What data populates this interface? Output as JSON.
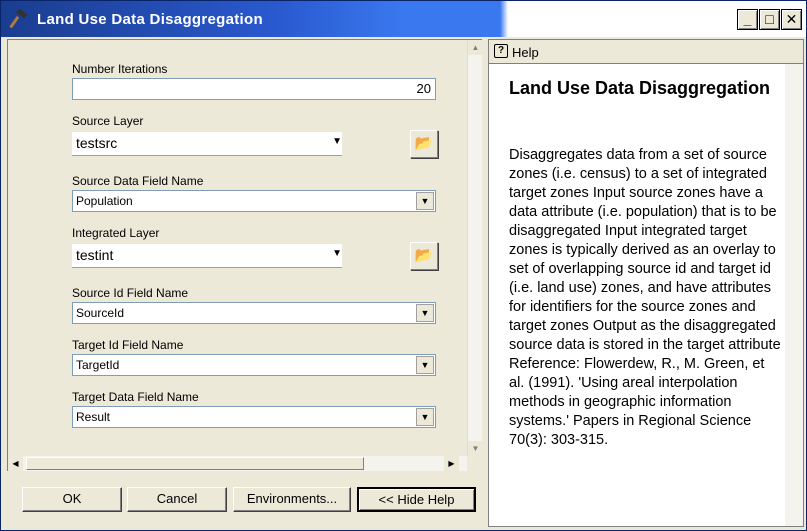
{
  "window": {
    "title": "Land Use Data Disaggregation",
    "min_glyph": "_",
    "max_glyph": "□",
    "close_glyph": "✕"
  },
  "form": {
    "iterations": {
      "label": "Number Iterations",
      "value": "20"
    },
    "source_layer": {
      "label": "Source Layer",
      "value": "testsrc"
    },
    "source_data_field": {
      "label": "Source Data Field Name",
      "value": "Population"
    },
    "integrated_layer": {
      "label": "Integrated Layer",
      "value": "testint"
    },
    "source_id_field": {
      "label": "Source Id Field Name",
      "value": "SourceId"
    },
    "target_id_field": {
      "label": "Target Id Field Name",
      "value": "TargetId"
    },
    "target_data_field": {
      "label": "Target Data Field Name",
      "value": "Result"
    }
  },
  "buttons": {
    "ok": "OK",
    "cancel": "Cancel",
    "environments": "Environments...",
    "hide_help": "<< Hide Help"
  },
  "help": {
    "tab_label": "Help",
    "title": "Land Use Data Disaggregation",
    "body": "Disaggregates data from a set of source zones (i.e. census) to a set of integrated target zones Input source zones have a data attribute (i.e. population) that is to be disaggregated Input integrated target zones is typically derived as an overlay to set of overlapping source id and target id (i.e. land use) zones, and have attributes for identifiers for the source zones and target zones Output as the disaggregated source data is stored in the target attribute Reference: Flowerdew, R., M. Green, et al. (1991). 'Using areal interpolation methods in geographic information systems.' Papers in Regional Science 70(3): 303-315."
  },
  "icons": {
    "title_icon": "hammer-icon",
    "folder": "open-folder-icon",
    "dropdown": "chevron-down-icon",
    "help": "help-page-icon"
  }
}
